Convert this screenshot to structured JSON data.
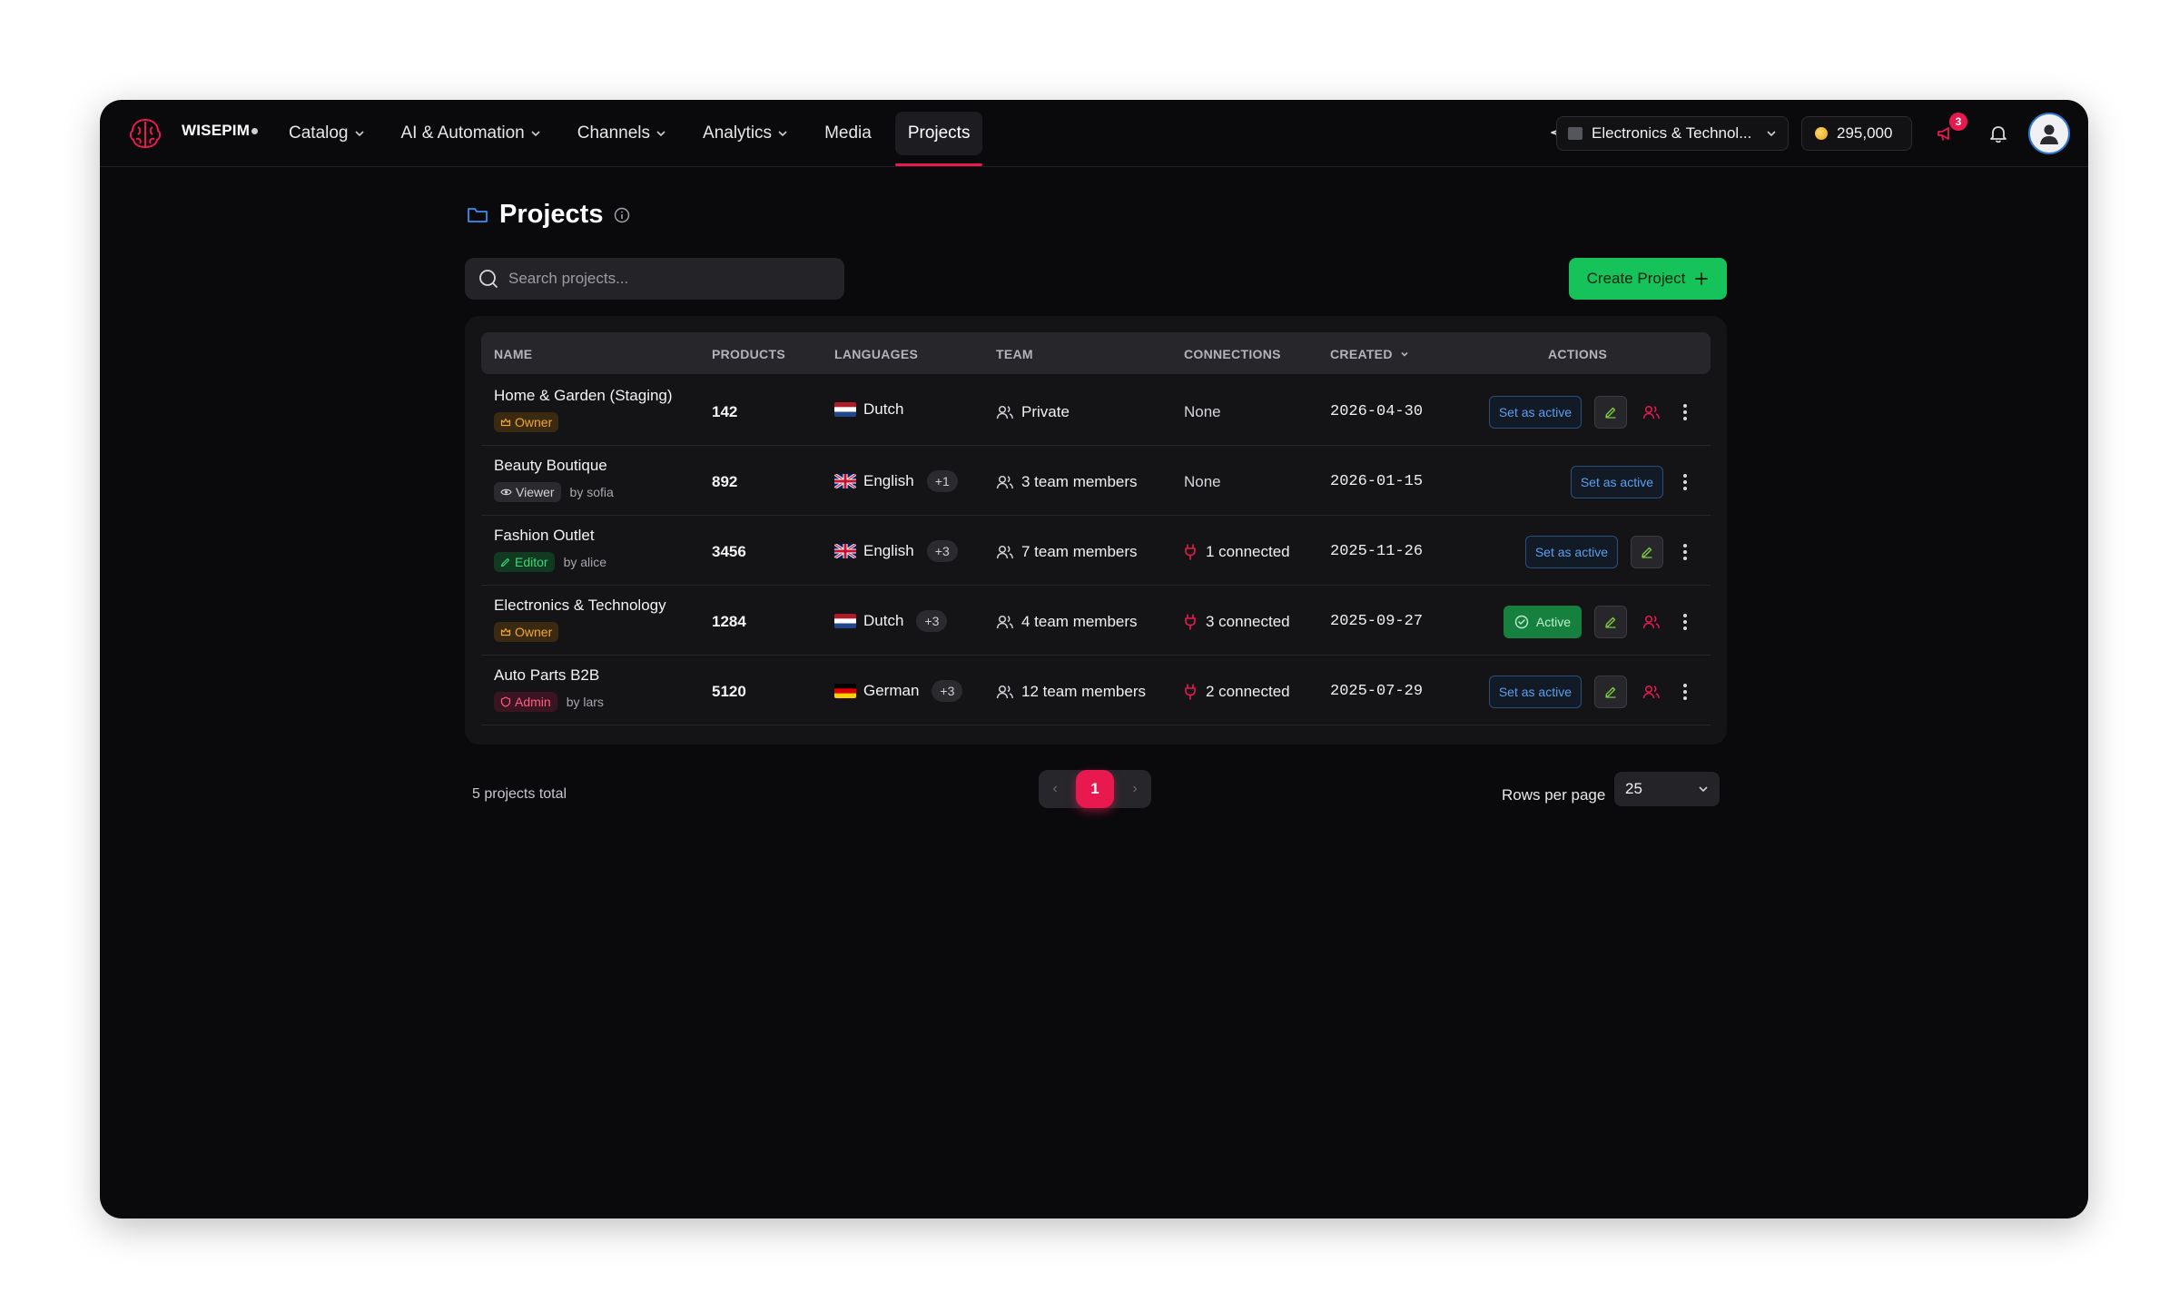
{
  "app": {
    "brand": "WISEPIM"
  },
  "nav": {
    "items": [
      {
        "label": "Catalog",
        "dropdown": true
      },
      {
        "label": "AI & Automation",
        "dropdown": true
      },
      {
        "label": "Channels",
        "dropdown": true
      },
      {
        "label": "Analytics",
        "dropdown": true
      },
      {
        "label": "Media",
        "dropdown": false
      },
      {
        "label": "Projects",
        "dropdown": false,
        "active": true
      }
    ],
    "store_select": "Electronics & Technol...",
    "credits": "295,000",
    "notification_count": "3"
  },
  "page": {
    "title": "Projects",
    "search_placeholder": "Search projects...",
    "create_button": "Create Project"
  },
  "table": {
    "headers": {
      "name": "NAME",
      "products": "PRODUCTS",
      "languages": "LANGUAGES",
      "team": "TEAM",
      "connections": "CONNECTIONS",
      "created": "CREATED",
      "actions": "ACTIONS"
    },
    "rows": [
      {
        "name": "Home & Garden (Staging)",
        "role": "Owner",
        "by": "",
        "products": "142",
        "language": "Dutch",
        "language_flag": "nl",
        "extra_languages": "",
        "team": "Private",
        "connections": "None",
        "created": "2026-04-30",
        "set_active_label": "Set as active",
        "is_active": false
      },
      {
        "name": "Beauty Boutique",
        "role": "Viewer",
        "by": "by sofia",
        "products": "892",
        "language": "English",
        "language_flag": "gb",
        "extra_languages": "+1",
        "team": "3 team members",
        "connections": "None",
        "created": "2026-01-15",
        "set_active_label": "Set as active",
        "is_active": false
      },
      {
        "name": "Fashion Outlet",
        "role": "Editor",
        "by": "by alice",
        "products": "3456",
        "language": "English",
        "language_flag": "gb",
        "extra_languages": "+3",
        "team": "7 team members",
        "connections": "1 connected",
        "created": "2025-11-26",
        "set_active_label": "Set as active",
        "is_active": false
      },
      {
        "name": "Electronics & Technology",
        "role": "Owner",
        "by": "",
        "products": "1284",
        "language": "Dutch",
        "language_flag": "nl",
        "extra_languages": "+3",
        "team": "4 team members",
        "connections": "3 connected",
        "created": "2025-09-27",
        "active_label": "Active",
        "is_active": true
      },
      {
        "name": "Auto Parts B2B",
        "role": "Admin",
        "by": "by lars",
        "products": "5120",
        "language": "German",
        "language_flag": "de",
        "extra_languages": "+3",
        "team": "12 team members",
        "connections": "2 connected",
        "created": "2025-07-29",
        "set_active_label": "Set as active",
        "is_active": false
      }
    ]
  },
  "footer": {
    "total": "5 projects total",
    "current_page": "1",
    "rows_per_page_label": "Rows per page",
    "rows_per_page_value": "25"
  },
  "colors": {
    "accent": "#e8194f",
    "primary_green": "#16c25a",
    "background": "#0a0a0c"
  }
}
